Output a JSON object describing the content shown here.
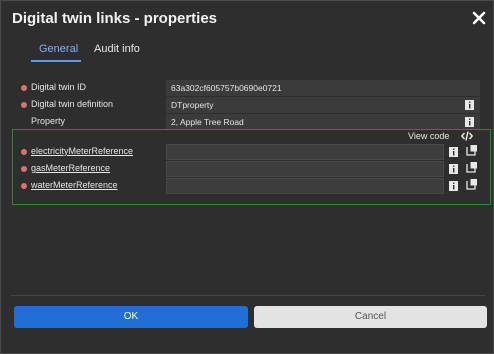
{
  "dialog": {
    "title": "Digital twin links - properties"
  },
  "tabs": [
    {
      "label": "General",
      "active": true
    },
    {
      "label": "Audit info",
      "active": false
    }
  ],
  "fields": [
    {
      "label": "Digital twin ID",
      "value": "63a302cf605757b0690e0721",
      "required": true,
      "info": false
    },
    {
      "label": "Digital twin definition",
      "value": "DTproperty",
      "required": true,
      "info": true
    },
    {
      "label": "Property",
      "value": "2, Apple Tree Road",
      "required": false,
      "info": true
    }
  ],
  "references": {
    "view_code_label": "View code",
    "items": [
      {
        "label": "electricityMeterReference",
        "value": ""
      },
      {
        "label": "gasMeterReference",
        "value": ""
      },
      {
        "label": "waterMeterReference",
        "value": ""
      }
    ]
  },
  "footer": {
    "ok_label": "OK",
    "cancel_label": "Cancel"
  },
  "colors": {
    "accent": "#1f6fd6",
    "tab_active": "#7fb2ff",
    "required_dot": "#e26f6f",
    "panel_border": "#2c8a2c"
  }
}
